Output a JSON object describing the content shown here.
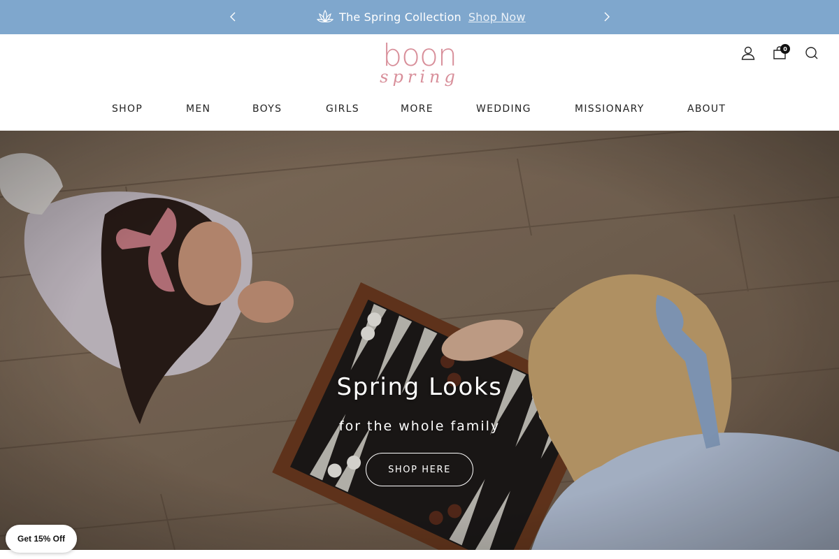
{
  "announcement": {
    "text": "The Spring Collection",
    "link": "Shop Now",
    "prev_icon": "chevron-left-icon",
    "next_icon": "chevron-right-icon",
    "icon": "lotus-icon",
    "background": "#7fa7cd"
  },
  "header": {
    "logo_line1": "boon",
    "logo_line2": "spring",
    "logo_color": "#d88f9a",
    "cart_count": "0",
    "icons": [
      "account-icon",
      "cart-icon",
      "search-icon"
    ]
  },
  "nav": {
    "items": [
      {
        "label": "SHOP"
      },
      {
        "label": "MEN"
      },
      {
        "label": "BOYS"
      },
      {
        "label": "GIRLS"
      },
      {
        "label": "MORE"
      },
      {
        "label": "WEDDING"
      },
      {
        "label": "MISSIONARY"
      },
      {
        "label": "ABOUT"
      }
    ]
  },
  "hero": {
    "title": "Spring Looks",
    "subtitle": "for the whole family",
    "button": "SHOP HERE"
  },
  "popup": {
    "discount_label": "Get 15% Off"
  }
}
